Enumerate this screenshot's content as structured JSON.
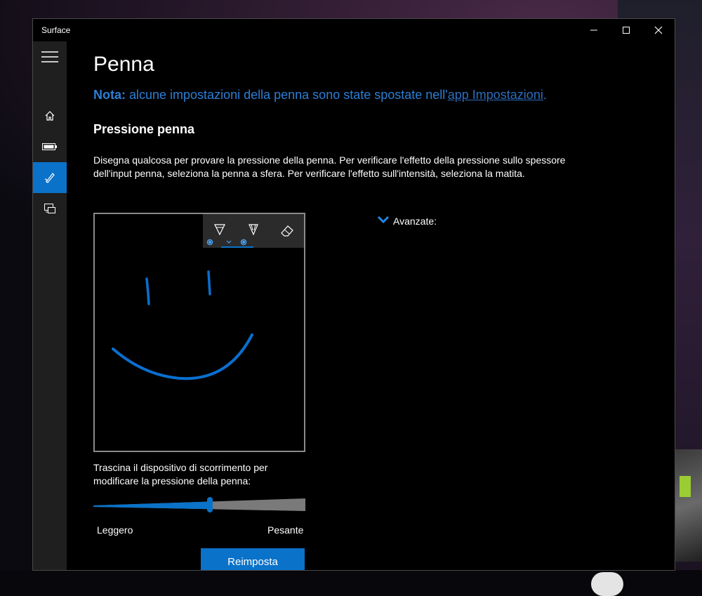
{
  "window": {
    "title": "Surface"
  },
  "nav": {
    "items": [
      {
        "name": "home",
        "icon": "home-icon"
      },
      {
        "name": "battery",
        "icon": "battery-icon"
      },
      {
        "name": "pen",
        "icon": "pen-icon",
        "selected": true
      },
      {
        "name": "devices",
        "icon": "devices-icon"
      }
    ],
    "footer_icon": "info-icon"
  },
  "page": {
    "title": "Penna",
    "note": {
      "label": "Nota:",
      "text": " alcune impostazioni della penna sono state spostate nell'",
      "link": "app Impostazioni",
      "suffix": "."
    },
    "section_title": "Pressione penna",
    "description": "Disegna qualcosa per provare la pressione della penna. Per verificare l'effetto della pressione sullo spessore dell'input penna, seleziona la penna a sfera. Per verificare l'effetto sull'intensità, seleziona la matita.",
    "advanced_label": "Avanzate:",
    "slider": {
      "caption": "Trascina il dispositivo di scorrimento per modificare la pressione della penna:",
      "min_label": "Leggero",
      "max_label": "Pesante",
      "value_fraction": 0.55
    },
    "reset_label": "Reimposta",
    "toolbar": {
      "tools": [
        "ballpoint-pen",
        "pencil",
        "eraser"
      ],
      "selected": "ballpoint-pen"
    }
  },
  "colors": {
    "accent": "#0a72c8",
    "note_text": "#2b7fd6",
    "window_bg": "#000000",
    "nav_bg": "#1f1f1f",
    "ink": "#0a6fd0"
  }
}
